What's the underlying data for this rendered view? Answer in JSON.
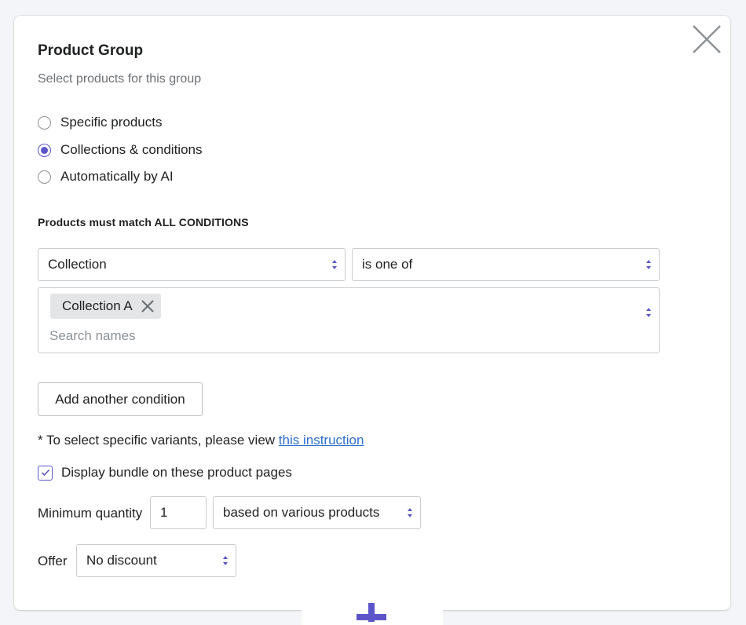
{
  "modal": {
    "title": "Product Group",
    "subtitle": "Select products for this group"
  },
  "selection_mode": {
    "options": [
      {
        "label": "Specific products",
        "checked": false
      },
      {
        "label": "Collections & conditions",
        "checked": true
      },
      {
        "label": "Automatically by AI",
        "checked": false
      }
    ]
  },
  "conditions": {
    "heading": "Products must match ALL CONDITIONS",
    "field_value": "Collection",
    "operator_value": "is one of",
    "selected_tags": [
      "Collection A"
    ],
    "search_placeholder": "Search names",
    "add_button_label": "Add another condition"
  },
  "variants_note": {
    "text": "* To select specific variants, please view ",
    "link_text": "this instruction"
  },
  "display_bundle": {
    "label": "Display bundle on these product pages",
    "checked": true
  },
  "minimum_quantity": {
    "label": "Minimum quantity",
    "value": "1",
    "basis_value": "based on various products"
  },
  "offer": {
    "label": "Offer",
    "value": "No discount"
  },
  "colors": {
    "accent": "#5c55c9",
    "link": "#2c6ecb",
    "border": "#c9cccf",
    "muted_text": "#6d7175",
    "chip_bg": "#e4e5e7"
  },
  "icons": {
    "close": "close-icon",
    "select_arrows": "updown-icon",
    "chip_remove": "close-icon",
    "check": "checkmark-icon",
    "add": "plus-icon"
  }
}
